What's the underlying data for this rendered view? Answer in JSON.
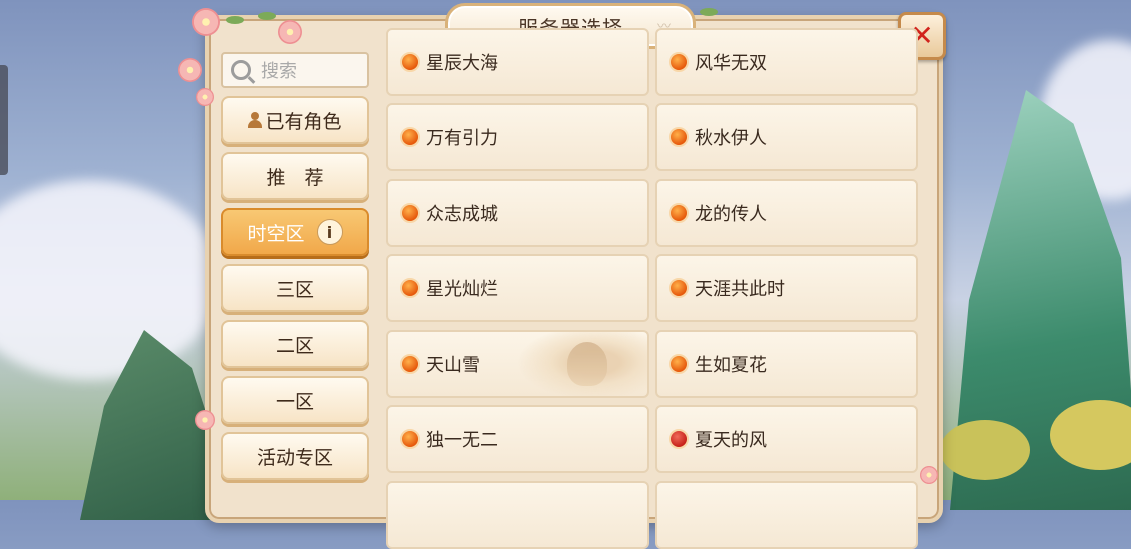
{
  "dialog": {
    "title": "服务器选择"
  },
  "search": {
    "placeholder": "搜索"
  },
  "sidebar": {
    "items": [
      {
        "label": "已有角色",
        "icon": "user-icon",
        "active": false
      },
      {
        "label": "推　荐",
        "active": false
      },
      {
        "label": "时空区",
        "icon": "info-icon",
        "active": true
      },
      {
        "label": "三区",
        "active": false
      },
      {
        "label": "二区",
        "active": false
      },
      {
        "label": "一区",
        "active": false
      },
      {
        "label": "活动专区",
        "active": false
      }
    ],
    "info_glyph": "i"
  },
  "servers": [
    {
      "name": "星辰大海",
      "status": "orange"
    },
    {
      "name": "风华无双",
      "status": "orange"
    },
    {
      "name": "万有引力",
      "status": "orange"
    },
    {
      "name": "秋水伊人",
      "status": "orange"
    },
    {
      "name": "众志成城",
      "status": "orange"
    },
    {
      "name": "龙的传人",
      "status": "orange"
    },
    {
      "name": "星光灿烂",
      "status": "orange"
    },
    {
      "name": "天涯共此时",
      "status": "orange"
    },
    {
      "name": "天山雪",
      "status": "orange"
    },
    {
      "name": "生如夏花",
      "status": "orange"
    },
    {
      "name": "独一无二",
      "status": "orange"
    },
    {
      "name": "夏天的风",
      "status": "red"
    }
  ],
  "colors": {
    "accent": "#f1a84a",
    "status_orange": "#e6590c",
    "status_red": "#c7221a",
    "close": "#d1231c"
  },
  "icons": {
    "close": "close-icon",
    "search": "search-icon"
  }
}
